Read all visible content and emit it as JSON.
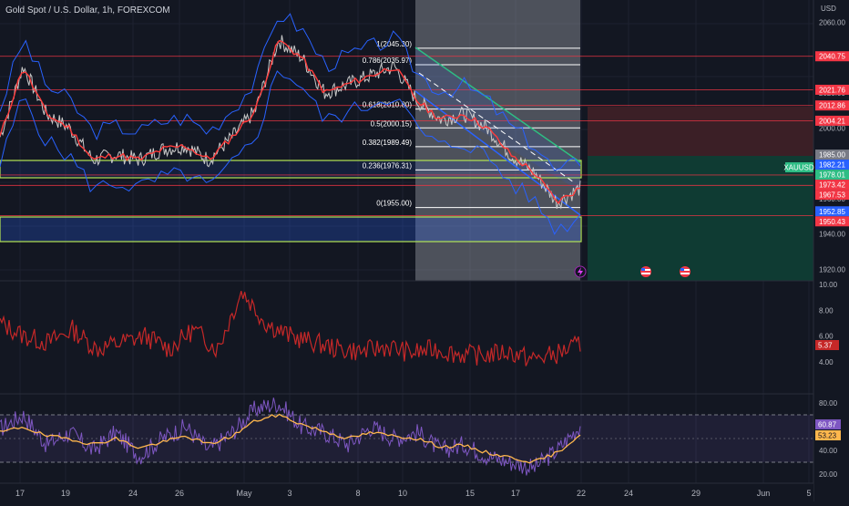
{
  "header": {
    "title": "Gold Spot / U.S. Dollar, 1h, FOREXCOM"
  },
  "colors": {
    "background": "#131722",
    "grid": "#1e2230",
    "price_line": "#e8e8e8",
    "bollinger": "#2962ff",
    "ma": "#ff3b3b",
    "fib": "#ffffff",
    "channel_blue": "#2962ff",
    "channel_green": "#2ebd85",
    "atr": "#c62828",
    "rsi": "#7e57c2",
    "rsi_ma": "#ffb74d",
    "red_level": "#f23645",
    "green_zone": "#0f3b33",
    "red_zone": "#3b1f26"
  },
  "price_axis": {
    "currency": "USD",
    "ticks": [
      "2060.00",
      "2040.00",
      "2020.00",
      "2000.00",
      "1980.00",
      "1960.00",
      "1940.00",
      "1920.00"
    ],
    "badges": [
      {
        "label": "2040.75",
        "value": 2040.75,
        "color": "#f23645"
      },
      {
        "label": "2021.76",
        "value": 2021.76,
        "color": "#f23645"
      },
      {
        "label": "2012.86",
        "value": 2012.86,
        "color": "#f23645"
      },
      {
        "label": "2004.21",
        "value": 2004.21,
        "color": "#f23645"
      },
      {
        "label": "1985.00",
        "value": 1985.0,
        "color": "#787b86"
      },
      {
        "label": "1982.21",
        "value": 1982.21,
        "color": "#2962ff"
      },
      {
        "label": "1978.01",
        "value": 1978.01,
        "color": "#2ebd85"
      },
      {
        "label": "1973.42",
        "value": 1973.42,
        "color": "#f23645"
      },
      {
        "label": "1967.53",
        "value": 1967.53,
        "color": "#f23645"
      },
      {
        "label": "1952.85",
        "value": 1952.85,
        "color": "#2962ff"
      },
      {
        "label": "1950.43",
        "value": 1950.43,
        "color": "#f23645"
      }
    ],
    "symbol_tag": "XAUUSD"
  },
  "fibonacci": [
    {
      "label": "1(2045.30)",
      "value": 2045.3
    },
    {
      "label": "0.786(2035.97)",
      "value": 2035.97
    },
    {
      "label": "0.618(2010.80)",
      "value": 2010.8
    },
    {
      "label": "0.5(2000.15)",
      "value": 2000.15
    },
    {
      "label": "0.382(1989.49)",
      "value": 1989.49
    },
    {
      "label": "0.236(1976.31)",
      "value": 1976.31
    },
    {
      "label": "0(1955.00)",
      "value": 1955.0
    }
  ],
  "atr_axis": {
    "ticks": [
      "10.00",
      "8.00",
      "6.00",
      "4.00"
    ],
    "current": "5.37"
  },
  "rsi_axis": {
    "ticks": [
      "80.00",
      "60.00",
      "40.00",
      "20.00"
    ],
    "current": "60.87",
    "ma_current": "53.23"
  },
  "time_axis": {
    "labels": [
      "17",
      "19",
      "24",
      "26",
      "May",
      "3",
      "8",
      "10",
      "15",
      "17",
      "22",
      "24",
      "29",
      "Jun",
      "5"
    ]
  },
  "chart_data": {
    "type": "line",
    "title": "Gold Spot / U.S. Dollar, 1h, FOREXCOM",
    "xlabel": "",
    "ylabel": "",
    "ylim": [
      1915,
      2068
    ],
    "x": [
      0,
      4,
      8,
      12,
      16,
      20,
      24,
      28,
      32,
      36,
      40,
      44,
      48,
      52,
      56,
      60,
      64,
      68,
      72,
      76,
      80,
      84,
      88,
      92,
      96,
      100
    ],
    "series": [
      {
        "values": [
          1995,
          2035,
          2008,
          2000,
          1982,
          1985,
          1982,
          1988,
          1990,
          1982,
          1995,
          2010,
          2050,
          2040,
          2020,
          2025,
          2030,
          2035,
          2015,
          2005,
          2008,
          2000,
          1985,
          1975,
          1958,
          1966
        ]
      }
    ],
    "atr": [
      7.0,
      6.0,
      5.5,
      6.5,
      5.0,
      5.5,
      6.0,
      5.0,
      6.5,
      5.0,
      9.5,
      7.0,
      6.0,
      5.5,
      5.0,
      4.8,
      5.2,
      4.7,
      5.0,
      4.6,
      4.5,
      4.8,
      4.2,
      4.6,
      5.37
    ],
    "rsi": [
      58,
      70,
      45,
      55,
      40,
      55,
      35,
      50,
      60,
      40,
      55,
      75,
      80,
      60,
      55,
      45,
      60,
      50,
      55,
      40,
      45,
      35,
      30,
      25,
      40,
      60.87
    ],
    "rsi_ma": [
      55,
      60,
      52,
      50,
      45,
      50,
      42,
      47,
      52,
      45,
      52,
      65,
      70,
      62,
      56,
      50,
      55,
      52,
      50,
      43,
      44,
      38,
      34,
      30,
      38,
      53.23
    ]
  }
}
